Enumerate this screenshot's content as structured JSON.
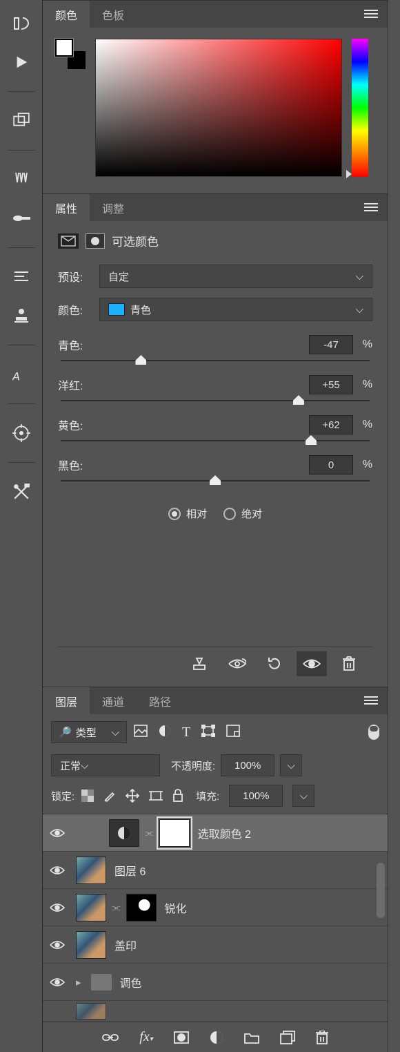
{
  "colorPanel": {
    "tabs": {
      "color": "颜色",
      "swatches": "色板"
    }
  },
  "propertiesPanel": {
    "tabs": {
      "properties": "属性",
      "adjustments": "调整"
    },
    "title": "可选颜色",
    "preset": {
      "label": "预设:",
      "value": "自定"
    },
    "colorTarget": {
      "label": "颜色:",
      "value": "青色"
    },
    "sliders": {
      "cyan": {
        "label": "青色:",
        "value": "-47",
        "pct": 26
      },
      "magenta": {
        "label": "洋红:",
        "value": "+55",
        "pct": 77
      },
      "yellow": {
        "label": "黄色:",
        "value": "+62",
        "pct": 81
      },
      "black": {
        "label": "黑色:",
        "value": "0",
        "pct": 50
      }
    },
    "radios": {
      "relative": "相对",
      "absolute": "绝对"
    },
    "unit": "%"
  },
  "layersPanel": {
    "tabs": {
      "layers": "图层",
      "channels": "通道",
      "paths": "路径"
    },
    "typeFilter": "类型",
    "blendMode": "正常",
    "opacityLabel": "不透明度:",
    "opacityValue": "100%",
    "lockLabel": "锁定:",
    "fillLabel": "填充:",
    "fillValue": "100%",
    "layers": [
      {
        "name": "选取颜色 2"
      },
      {
        "name": "图层 6"
      },
      {
        "name": "锐化"
      },
      {
        "name": "盖印"
      },
      {
        "name": "调色"
      }
    ]
  }
}
